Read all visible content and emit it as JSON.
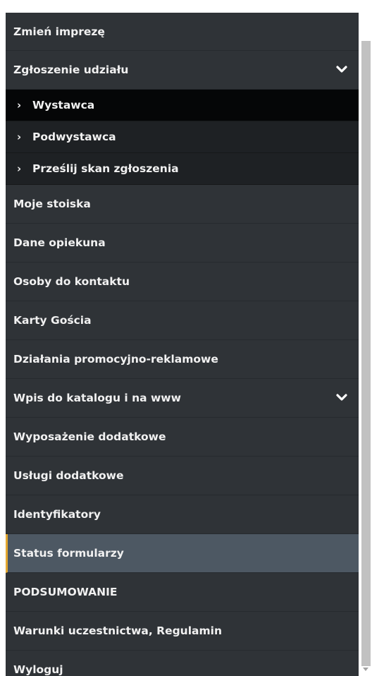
{
  "menu": {
    "change_event": "Zmień imprezę",
    "registration": {
      "label": "Zgłoszenie udziału",
      "expand_icon": "chevron-down-icon",
      "subitems": [
        {
          "label": "Wystawca",
          "selected": true
        },
        {
          "label": "Podwystawca",
          "selected": false
        },
        {
          "label": "Prześlij skan zgłoszenia",
          "selected": false
        }
      ]
    },
    "my_booths": "Moje stoiska",
    "caretaker_data": "Dane opiekuna",
    "contact_persons": "Osoby do kontaktu",
    "guest_cards": "Karty Gościa",
    "promo_actions": "Działania promocyjno-reklamowe",
    "catalog_entry": {
      "label": "Wpis do katalogu i na www",
      "expand_icon": "chevron-down-icon"
    },
    "extra_equipment": "Wyposażenie dodatkowe",
    "extra_services": "Usługi dodatkowe",
    "identifiers": "Identyfikatory",
    "form_status": {
      "label": "Status formularzy",
      "active": true
    },
    "summary": "PODSUMOWANIE",
    "terms": "Warunki uczestnictwa, Regulamin",
    "logout": "Wyloguj"
  },
  "colors": {
    "menu_bg": "#2f3337",
    "submenu_bg": "#1e2124",
    "submenu_selected_bg": "#050607",
    "active_bg": "#4d5863",
    "active_accent": "#e3a72f",
    "text": "#f1f1f1"
  },
  "icons": {
    "submenu_arrow": "›"
  }
}
